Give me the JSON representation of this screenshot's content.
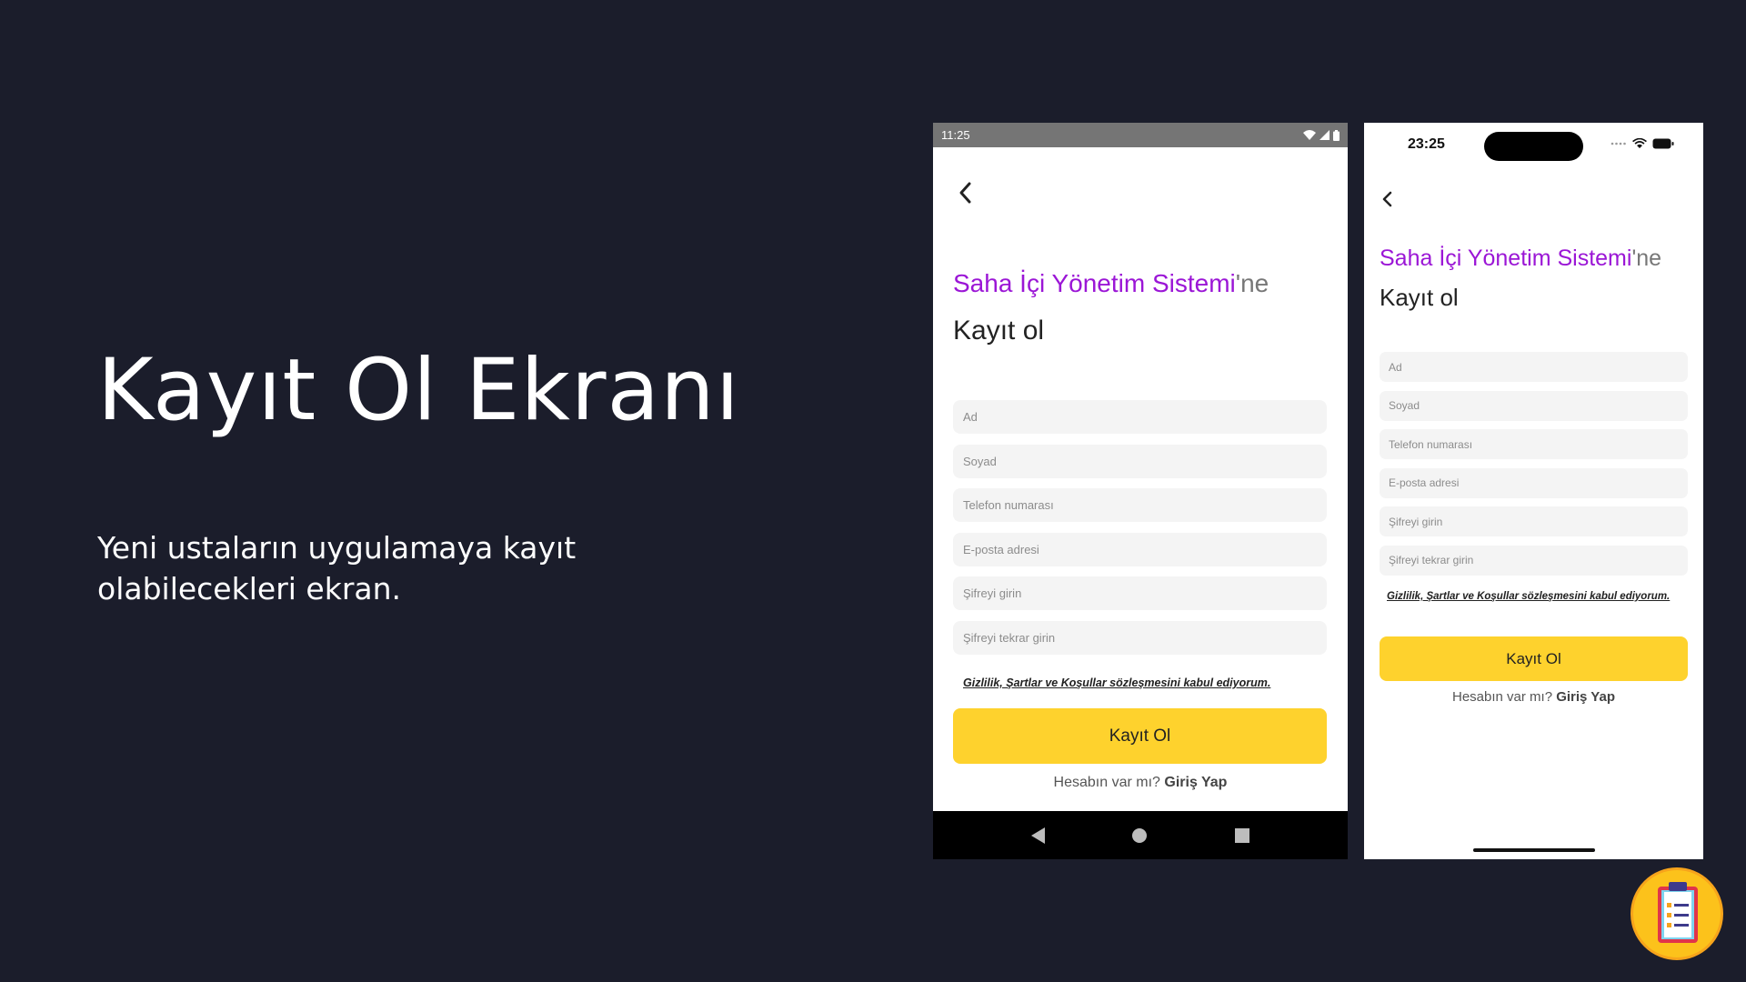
{
  "slide": {
    "title": "Kayıt Ol Ekranı",
    "description": "Yeni ustaların uygulamaya kayıt olabilecekleri ekran."
  },
  "android": {
    "status_time": "11:25",
    "heading_brand": "Saha İçi Yönetim Sistemi",
    "heading_suffix": "'ne",
    "heading_line2": "Kayıt ol",
    "fields": [
      "Ad",
      "Soyad",
      "Telefon numarası",
      "E-posta adresi",
      "Şifreyi girin",
      "Şifreyi tekrar girin"
    ],
    "terms": "Gizlilik, Şartlar ve Koşullar sözleşmesini kabul ediyorum.",
    "button": "Kayıt Ol",
    "login_prompt": "Hesabın var mı?",
    "login_link": "Giriş Yap"
  },
  "ios": {
    "status_time": "23:25",
    "heading_brand": "Saha İçi Yönetim Sistemi",
    "heading_suffix": "'ne",
    "heading_line2": "Kayıt ol",
    "fields": [
      "Ad",
      "Soyad",
      "Telefon numarası",
      "E-posta adresi",
      "Şifreyi girin",
      "Şifreyi tekrar girin"
    ],
    "terms": "Gizlilik, Şartlar ve Koşullar sözleşmesini kabul ediyorum.",
    "button": "Kayıt Ol",
    "login_prompt": "Hesabın var mı?",
    "login_link": "Giriş Yap"
  },
  "colors": {
    "background": "#1b1d2b",
    "brand_purple": "#9b16d6",
    "button_yellow": "#fed22d"
  },
  "icons": {
    "back": "chevron-left-icon",
    "app": "clipboard-icon"
  }
}
